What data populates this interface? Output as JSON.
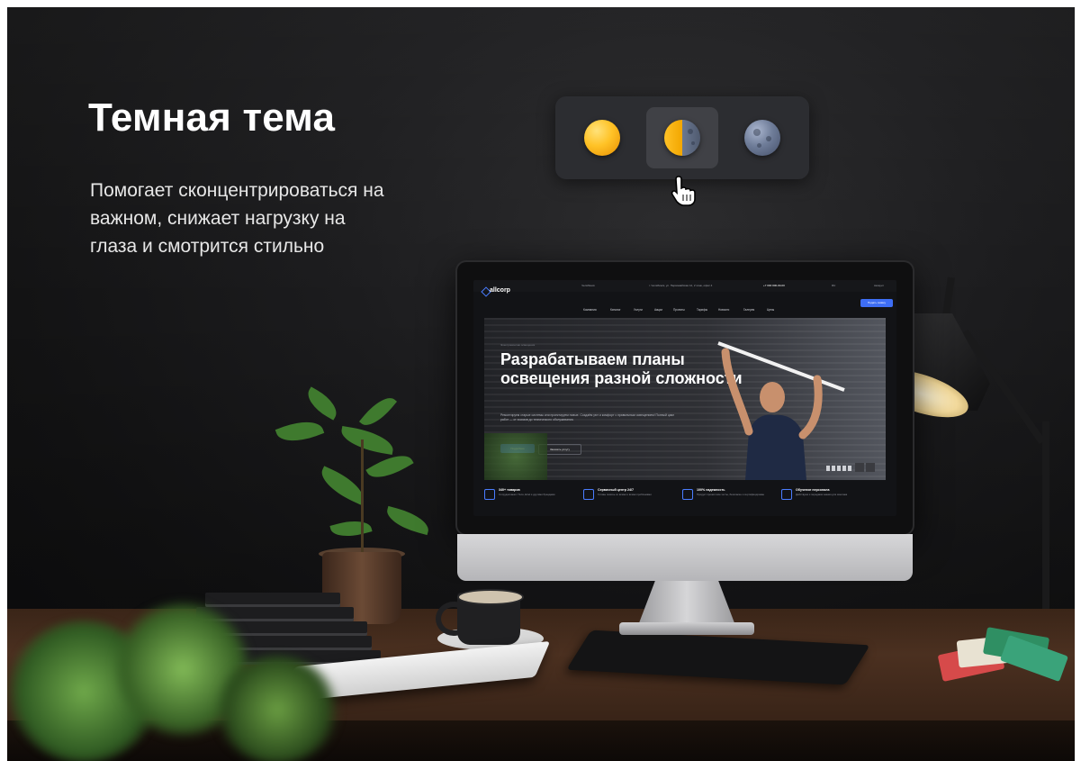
{
  "heading": {
    "title": "Темная тема",
    "description": "Помогает сконцентрироваться на важном, снижает нагрузку на глаза и смотрится стильно"
  },
  "theme_switcher": {
    "options": [
      {
        "label": "light-theme",
        "icon": "sun-icon"
      },
      {
        "label": "auto-theme",
        "icon": "half-sun-moon-icon"
      },
      {
        "label": "dark-theme",
        "icon": "moon-icon"
      }
    ],
    "selected_index": 1,
    "cursor_icon": "hand-pointer-icon"
  },
  "mock_site": {
    "logo": "aspro",
    "logo_brand": "allcorp",
    "topbar": {
      "city": "Челябинск",
      "address": "г. Челябинск, ул. Первомайская 12, 2 этаж, офис 4",
      "phone": "+7 000 000-00-00",
      "lang": "RU",
      "account": "Аккаунт"
    },
    "nav": [
      "Компания",
      "Каталог",
      "Услуги",
      "Акции",
      "Проекты",
      "Тарифы",
      "Новости",
      "Галерея",
      "Цены"
    ],
    "cta": "Подать заявку",
    "hero": {
      "breadcrumb": "Электромонтаж освещения",
      "headline": "Разрабатываем планы освещения разной сложности",
      "subtext": "Ремонтируем старые системы или проектируем новые. Создаём уют и комфорт с правильным освещением! Полный цикл работ — от эскизов до технического обслуживания.",
      "primary_button": "Подробнее",
      "secondary_button": "Заказать услугу"
    },
    "features": [
      {
        "title": "340+ товаров",
        "text": "Сотрудничаем с Tens, Etrel и другими брендами"
      },
      {
        "title": "Сервисный центр 24/7",
        "text": "Готовы помочь со всеми и всеми проблемами"
      },
      {
        "title": "100% надежность",
        "text": "Продукт прошёл все тесты, безопасен и сертифицирован"
      },
      {
        "title": "Обучение персонала",
        "text": "Действуем и передаём знания для монтажа"
      }
    ]
  },
  "colors": {
    "accent": "#3e6ef5",
    "background": "#151516",
    "switcher_bg": "#2c2d31",
    "switcher_active": "#404146",
    "sun": "#ffc226",
    "moon": "#6f7d99"
  }
}
